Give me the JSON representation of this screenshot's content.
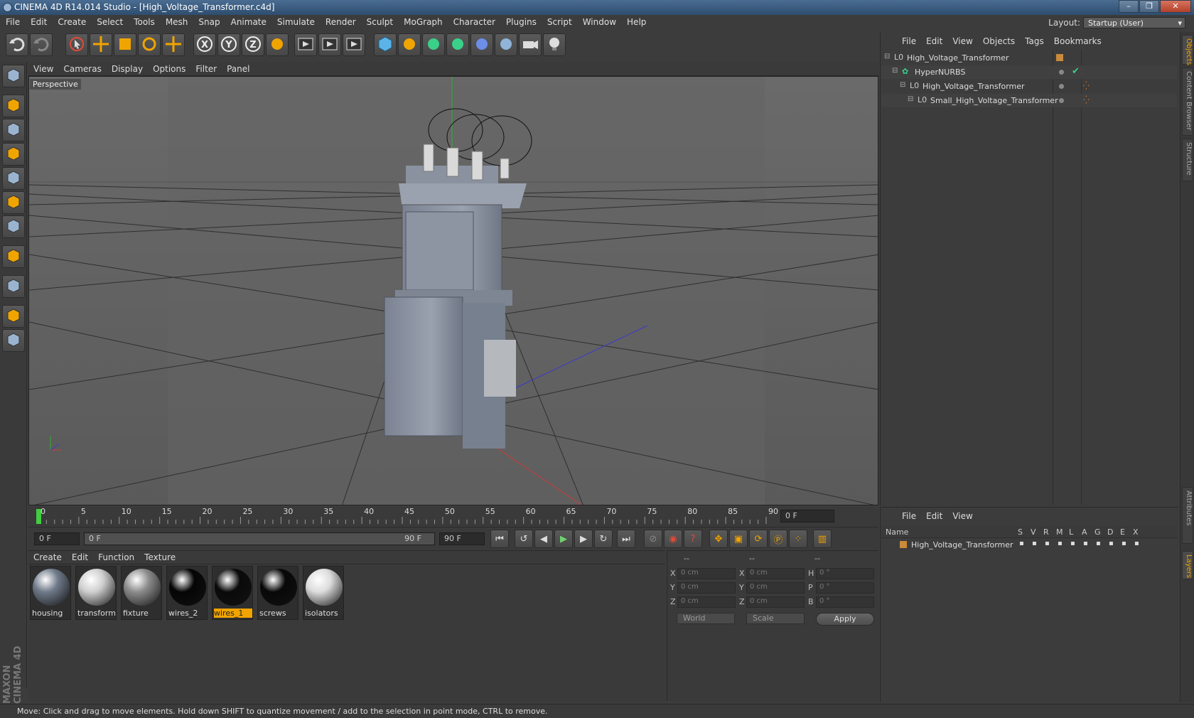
{
  "window": {
    "title": "CINEMA 4D R14.014 Studio - [High_Voltage_Transformer.c4d]"
  },
  "menubar": {
    "items": [
      "File",
      "Edit",
      "Create",
      "Select",
      "Tools",
      "Mesh",
      "Snap",
      "Animate",
      "Simulate",
      "Render",
      "Sculpt",
      "MoGraph",
      "Character",
      "Plugins",
      "Script",
      "Window",
      "Help"
    ]
  },
  "layout": {
    "label": "Layout:",
    "value": "Startup (User)"
  },
  "toolbar": {
    "icons": [
      "undo-icon",
      "redo-icon",
      "live-select-icon",
      "move-icon",
      "scale-icon",
      "rotate-icon",
      "add-icon",
      "x-axis-icon",
      "y-axis-icon",
      "z-axis-icon",
      "coordinate-system-icon",
      "render-view-icon",
      "render-picture-viewer-icon",
      "render-settings-icon",
      "cube-icon",
      "spline-icon",
      "nurbs-icon",
      "array-icon",
      "deformer-icon",
      "floor-icon",
      "camera-icon",
      "light-icon"
    ]
  },
  "viewport": {
    "menu": [
      "View",
      "Cameras",
      "Display",
      "Options",
      "Filter",
      "Panel"
    ],
    "label": "Perspective"
  },
  "timeline": {
    "ticks": [
      "0",
      "5",
      "10",
      "15",
      "20",
      "25",
      "30",
      "35",
      "40",
      "45",
      "50",
      "55",
      "60",
      "65",
      "70",
      "75",
      "80",
      "85",
      "90"
    ],
    "frame_field": "0 F",
    "current_frame": 0,
    "max_frame": 90
  },
  "playbar": {
    "start": "0 F",
    "range_start": "0 F",
    "range_end": "90 F",
    "end": "90 F"
  },
  "materials": {
    "menu": [
      "Create",
      "Edit",
      "Function",
      "Texture"
    ],
    "items": [
      {
        "name": "housing",
        "color": "#6f7a8a"
      },
      {
        "name": "transforma",
        "color": "#cfcfcf"
      },
      {
        "name": "fixture",
        "color": "#8c8c8c"
      },
      {
        "name": "wires_2",
        "color": "#050505"
      },
      {
        "name": "wires_1",
        "color": "#0a0a0a",
        "selected": true
      },
      {
        "name": "screws",
        "color": "#080808"
      },
      {
        "name": "isolators",
        "color": "#dcdcdc"
      }
    ]
  },
  "coordinates": {
    "headers": [
      "--",
      "--",
      "--"
    ],
    "rows": [
      {
        "axis": "X",
        "pos": "0 cm",
        "axis2": "X",
        "size": "0 cm",
        "rot_axis": "H",
        "rot": "0 °"
      },
      {
        "axis": "Y",
        "pos": "0 cm",
        "axis2": "Y",
        "size": "0 cm",
        "rot_axis": "P",
        "rot": "0 °"
      },
      {
        "axis": "Z",
        "pos": "0 cm",
        "axis2": "Z",
        "size": "0 cm",
        "rot_axis": "B",
        "rot": "0 °"
      }
    ],
    "mode": "World",
    "size_mode": "Scale",
    "apply": "Apply"
  },
  "objects": {
    "menu": [
      "File",
      "Edit",
      "View",
      "Objects",
      "Tags",
      "Bookmarks"
    ],
    "rows": [
      {
        "name": "High_Voltage_Transformer",
        "indent": 0
      },
      {
        "name": "HyperNURBS",
        "indent": 1
      },
      {
        "name": "High_Voltage_Transformer",
        "indent": 2
      },
      {
        "name": "Small_High_Voltage_Transformer",
        "indent": 3
      }
    ]
  },
  "layers": {
    "menu": [
      "File",
      "Edit",
      "View"
    ],
    "columns": [
      "Name",
      "S",
      "V",
      "R",
      "M",
      "L",
      "A",
      "G",
      "D",
      "E",
      "X"
    ],
    "rows": [
      {
        "name": "High_Voltage_Transformer"
      }
    ]
  },
  "right_tabs": [
    "Objects",
    "Content Browser",
    "Structure",
    "Attributes",
    "Layers"
  ],
  "status": "Move: Click and drag to move elements. Hold down SHIFT to quantize movement / add to the selection in point mode, CTRL to remove.",
  "brand": "MAXON CINEMA 4D",
  "colors": {
    "accent": "#f0a400",
    "viewport_bg": "#5e5e5e",
    "panel_bg": "#3c3c3c"
  }
}
